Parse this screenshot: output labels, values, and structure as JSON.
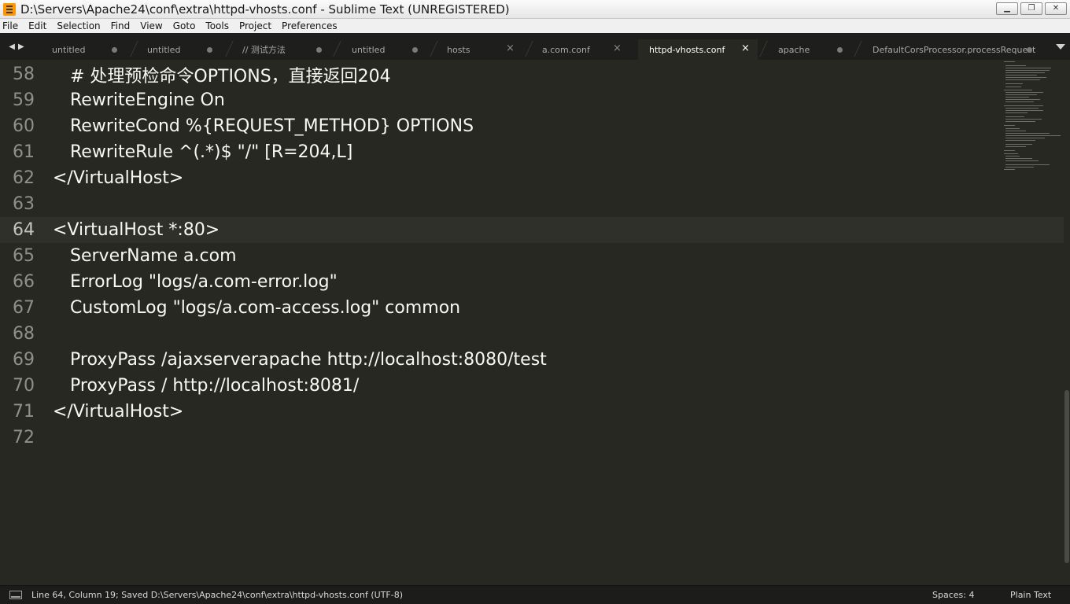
{
  "window": {
    "title": "D:\\Servers\\Apache24\\conf\\extra\\httpd-vhosts.conf - Sublime Text (UNREGISTERED)",
    "minimize_glyph": "▁",
    "restore_glyph": "❐",
    "close_glyph": "✕",
    "app_icon": "sublime-text-icon"
  },
  "menu": [
    "File",
    "Edit",
    "Selection",
    "Find",
    "View",
    "Goto",
    "Tools",
    "Project",
    "Preferences"
  ],
  "tab_nav": {
    "left": "◀",
    "right": "▶"
  },
  "tabs": [
    {
      "label": "untitled",
      "state": "dirty"
    },
    {
      "label": "untitled",
      "state": "dirty"
    },
    {
      "label": "// 测试方法",
      "state": "dirty"
    },
    {
      "label": "untitled",
      "state": "dirty"
    },
    {
      "label": "hosts",
      "state": "close"
    },
    {
      "label": "a.com.conf",
      "state": "close"
    },
    {
      "label": "httpd-vhosts.conf",
      "state": "active"
    },
    {
      "label": "apache",
      "state": "dirty"
    },
    {
      "label": "DefaultCorsProcessor.processRequest",
      "state": "dirty"
    }
  ],
  "close_glyph": "×",
  "editor": {
    "current_line": "64",
    "lines": [
      {
        "num": "58",
        "text": "# 处理预检命令OPTIONS，直接返回204",
        "indent": true
      },
      {
        "num": "59",
        "text": "RewriteEngine On",
        "indent": true
      },
      {
        "num": "60",
        "text": "RewriteCond %{REQUEST_METHOD} OPTIONS",
        "indent": true
      },
      {
        "num": "61",
        "text": "RewriteRule ^(.*)$ \"/\" [R=204,L]",
        "indent": true
      },
      {
        "num": "62",
        "text": "</VirtualHost>",
        "indent": false
      },
      {
        "num": "63",
        "text": "",
        "indent": false
      },
      {
        "num": "64",
        "text": "<VirtualHost *:80>",
        "indent": false
      },
      {
        "num": "65",
        "text": "ServerName a.com",
        "indent": true
      },
      {
        "num": "66",
        "text": "ErrorLog \"logs/a.com-error.log\"",
        "indent": true
      },
      {
        "num": "67",
        "text": "CustomLog \"logs/a.com-access.log\" common",
        "indent": true
      },
      {
        "num": "68",
        "text": "",
        "indent": false
      },
      {
        "num": "69",
        "text": "ProxyPass /ajaxserverapache http://localhost:8080/test",
        "indent": true
      },
      {
        "num": "70",
        "text": "ProxyPass / http://localhost:8081/",
        "indent": true
      },
      {
        "num": "71",
        "text": "</VirtualHost>",
        "indent": false
      },
      {
        "num": "72",
        "text": "",
        "indent": false
      }
    ]
  },
  "status": {
    "left": "Line 64, Column 19; Saved D:\\Servers\\Apache24\\conf\\extra\\httpd-vhosts.conf (UTF-8)",
    "spaces": "Spaces: 4",
    "syntax": "Plain Text",
    "panel_icon": "panel-toggle-icon"
  },
  "colors": {
    "background": "#272822",
    "text": "#f8f8f2",
    "gutter": "#8f908a",
    "tabbar": "#1e1f1c",
    "statusbar": "#1c1d1a"
  }
}
